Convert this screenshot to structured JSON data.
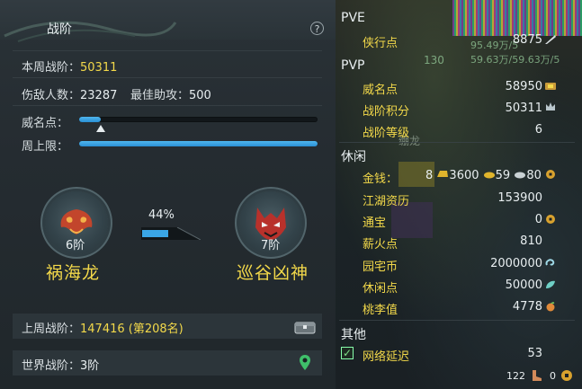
{
  "left": {
    "title": "战阶",
    "help": "?",
    "weekly_label": "本周战阶：",
    "weekly_value": "50311",
    "kills_label": "伤敌人数：",
    "kills_value": "23287",
    "assist_label": "最佳助攻：",
    "assist_value": "500",
    "fame_label": "威名点：",
    "fame_progress": 0.09,
    "cap_label": "周上限：",
    "cap_progress": 1.0,
    "current_rank": {
      "level": "6阶",
      "name": "祸海龙"
    },
    "next_rank": {
      "level": "7阶",
      "name": "巡谷凶神"
    },
    "progress_pct": "44%",
    "progress_value": 0.44,
    "last_week_label": "上周战阶：",
    "last_week_value": "147416 (第208名)",
    "world_label": "世界战阶：",
    "world_value": "3阶"
  },
  "right": {
    "pve": {
      "header": "PVE",
      "items": [
        {
          "label": "侠行点",
          "value": "8875",
          "icon": "quill-icon"
        }
      ],
      "overlay_lines": [
        "95.49万/5",
        "59.63万/59.63万/5",
        "130"
      ]
    },
    "pvp": {
      "header": "PVP",
      "items": [
        {
          "label": "威名点",
          "value": "58950",
          "icon": "badge-icon"
        },
        {
          "label": "战阶积分",
          "value": "50311",
          "icon": "crown-icon"
        },
        {
          "label": "战阶等级",
          "value": "6",
          "icon": ""
        }
      ]
    },
    "leisure": {
      "header": "休闲",
      "gold_label": "金钱：",
      "gold_parts": [
        "8",
        "3600",
        "59",
        "80"
      ],
      "items": [
        {
          "label": "江湖资历",
          "value": "153900",
          "icon": ""
        },
        {
          "label": "通宝",
          "value": "0",
          "icon": "coin-icon"
        },
        {
          "label": "薪火点",
          "value": "810",
          "icon": ""
        },
        {
          "label": "园宅币",
          "value": "2000000",
          "icon": "swirl-icon"
        },
        {
          "label": "休闲点",
          "value": "50000",
          "icon": "leaf-icon"
        },
        {
          "label": "桃李值",
          "value": "4778",
          "icon": "peach-icon"
        }
      ]
    },
    "other": {
      "header": "其他",
      "items": [
        {
          "label": "网络延迟",
          "value": "53"
        }
      ]
    },
    "footer": {
      "count": "122",
      "coins": "0"
    },
    "bg_label": "绷龙"
  },
  "colors": {
    "accent_yellow": "#f3d94a",
    "bar_blue": "#3aa6e6",
    "panel": "#252c31"
  }
}
